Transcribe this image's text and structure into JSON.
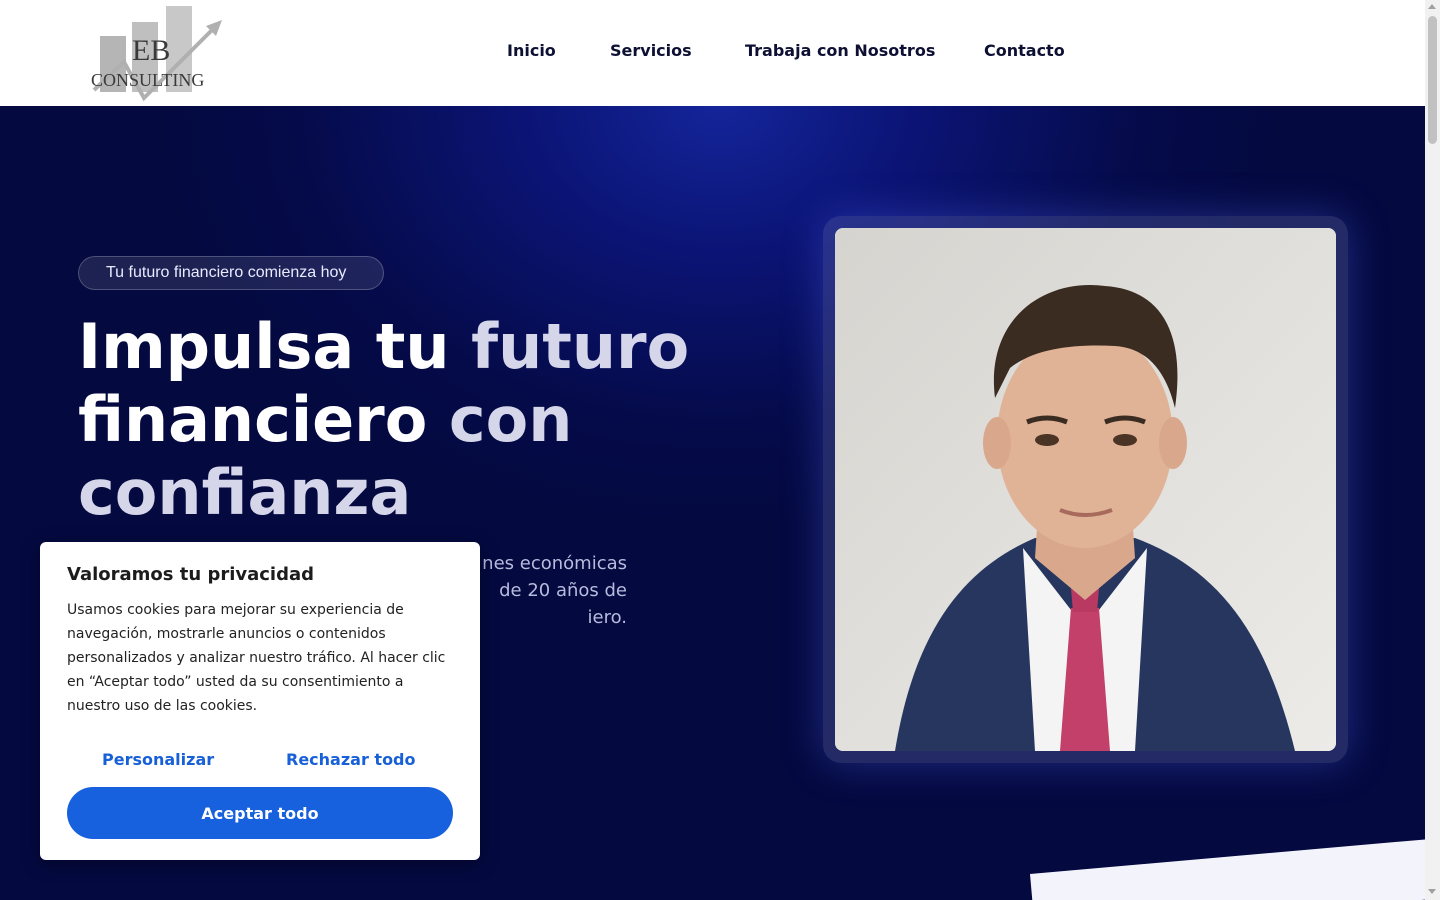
{
  "header": {
    "logo": {
      "line1": "EB",
      "line2": "CONSULTING"
    },
    "nav": [
      {
        "label": "Inicio"
      },
      {
        "label": "Servicios"
      },
      {
        "label": "Trabaja con Nosotros"
      },
      {
        "label": "Contacto"
      }
    ]
  },
  "hero": {
    "badge": "Tu futuro financiero comienza hoy",
    "headline": {
      "part1": "Impulsa tu ",
      "part2": "futuro",
      "part3": "financiero ",
      "part4": "con",
      "part5": "confianza"
    },
    "lead_visible": "nes económicas\nde 20 años de\niero."
  },
  "cookie": {
    "title": "Valoramos tu privacidad",
    "text": "Usamos cookies para mejorar su experiencia de navegación, mostrarle anuncios o contenidos personalizados y analizar nuestro tráfico. Al hacer clic en “Aceptar todo” usted da su consentimiento a nuestro uso de las cookies.",
    "customize": "Personalizar",
    "reject": "Rechazar todo",
    "accept": "Aceptar todo"
  },
  "colors": {
    "hero_bg": "#050b4a",
    "accent": "#1761de",
    "nav_text": "#0d1033"
  },
  "icons": [
    "logo-chart-icon",
    "scroll-up-icon",
    "scroll-down-icon"
  ]
}
